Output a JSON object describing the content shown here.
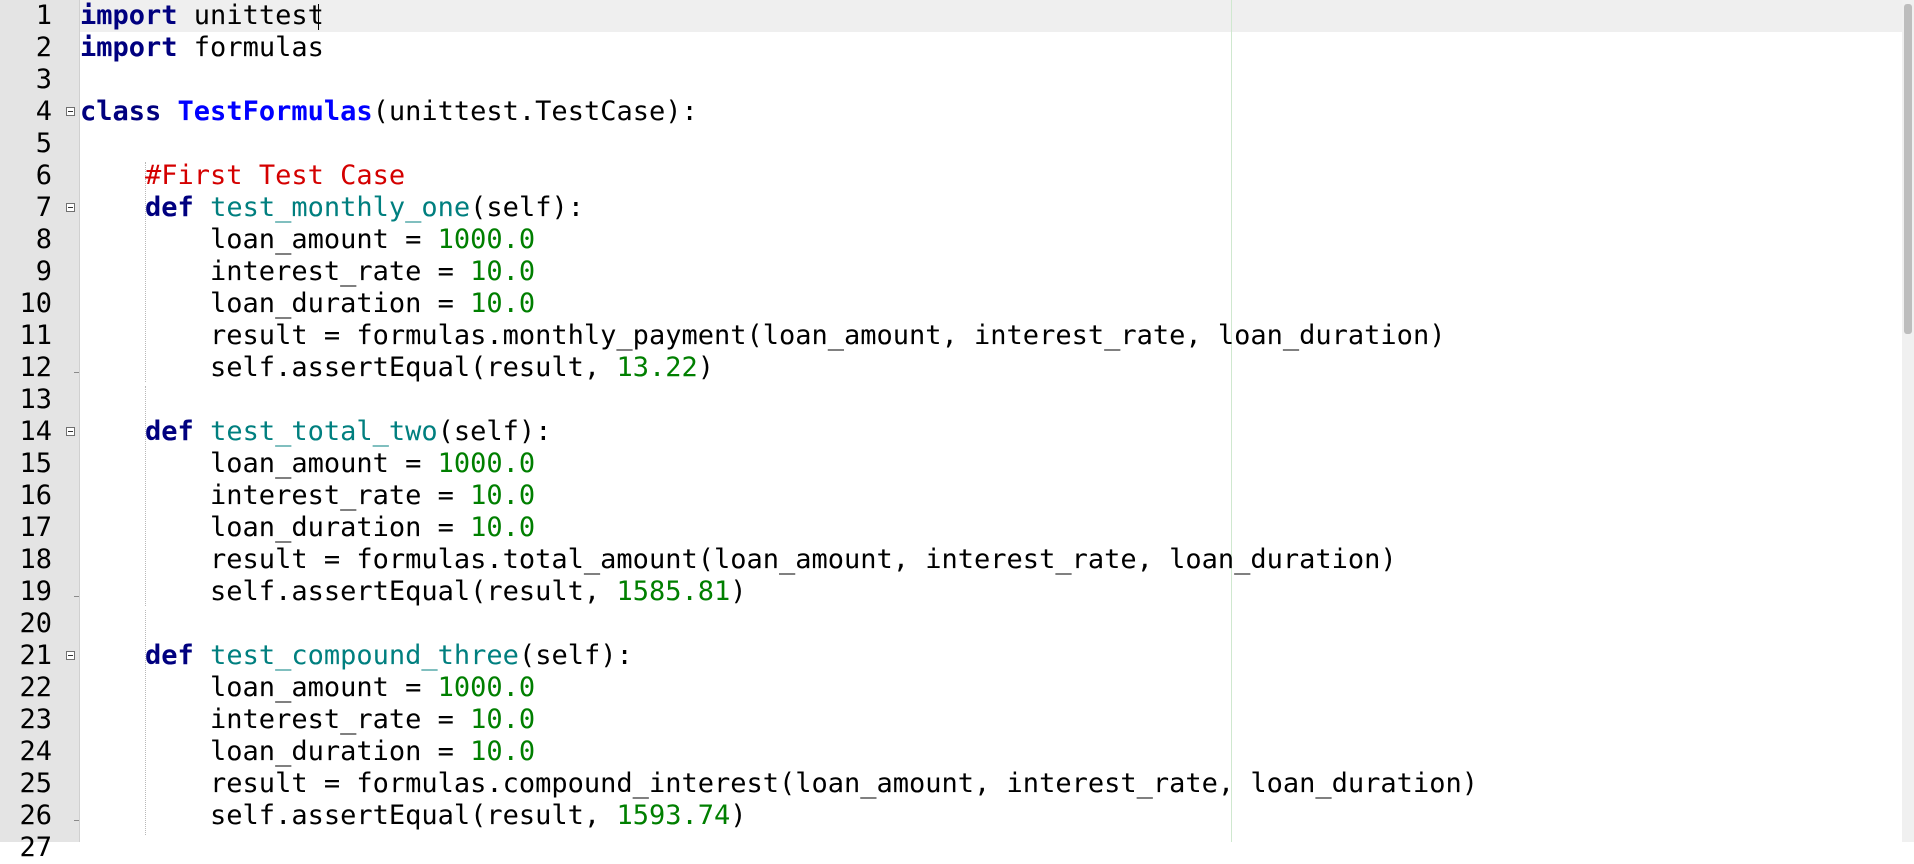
{
  "editor": {
    "line_numbers": [
      "1",
      "2",
      "3",
      "4",
      "5",
      "6",
      "7",
      "8",
      "9",
      "10",
      "11",
      "12",
      "13",
      "14",
      "15",
      "16",
      "17",
      "18",
      "19",
      "20",
      "21",
      "22",
      "23",
      "24",
      "25",
      "26",
      "27"
    ],
    "lines": [
      {
        "tokens": [
          {
            "t": "import",
            "c": "kw"
          },
          {
            "t": " unittest",
            "c": "p"
          }
        ]
      },
      {
        "tokens": [
          {
            "t": "import",
            "c": "kw"
          },
          {
            "t": " formulas",
            "c": "p"
          }
        ]
      },
      {
        "tokens": []
      },
      {
        "tokens": [
          {
            "t": "class",
            "c": "kw"
          },
          {
            "t": " ",
            "c": "p"
          },
          {
            "t": "TestFormulas",
            "c": "cls"
          },
          {
            "t": "(unittest.TestCase):",
            "c": "p"
          }
        ]
      },
      {
        "tokens": []
      },
      {
        "tokens": [
          {
            "t": "    ",
            "c": "p"
          },
          {
            "t": "#First Test Case",
            "c": "cm"
          }
        ]
      },
      {
        "tokens": [
          {
            "t": "    ",
            "c": "p"
          },
          {
            "t": "def",
            "c": "kw"
          },
          {
            "t": " ",
            "c": "p"
          },
          {
            "t": "test_monthly_one",
            "c": "fn"
          },
          {
            "t": "(self):",
            "c": "p"
          }
        ]
      },
      {
        "tokens": [
          {
            "t": "        loan_amount = ",
            "c": "p"
          },
          {
            "t": "1000.0",
            "c": "num"
          }
        ]
      },
      {
        "tokens": [
          {
            "t": "        interest_rate = ",
            "c": "p"
          },
          {
            "t": "10.0",
            "c": "num"
          }
        ]
      },
      {
        "tokens": [
          {
            "t": "        loan_duration = ",
            "c": "p"
          },
          {
            "t": "10.0",
            "c": "num"
          }
        ]
      },
      {
        "tokens": [
          {
            "t": "        result = formulas.monthly_payment(loan_amount, interest_rate, loan_duration)",
            "c": "p"
          }
        ]
      },
      {
        "tokens": [
          {
            "t": "        self.assertEqual(result, ",
            "c": "p"
          },
          {
            "t": "13.22",
            "c": "num"
          },
          {
            "t": ")",
            "c": "p"
          }
        ]
      },
      {
        "tokens": []
      },
      {
        "tokens": [
          {
            "t": "    ",
            "c": "p"
          },
          {
            "t": "def",
            "c": "kw"
          },
          {
            "t": " ",
            "c": "p"
          },
          {
            "t": "test_total_two",
            "c": "fn"
          },
          {
            "t": "(self):",
            "c": "p"
          }
        ]
      },
      {
        "tokens": [
          {
            "t": "        loan_amount = ",
            "c": "p"
          },
          {
            "t": "1000.0",
            "c": "num"
          }
        ]
      },
      {
        "tokens": [
          {
            "t": "        interest_rate = ",
            "c": "p"
          },
          {
            "t": "10.0",
            "c": "num"
          }
        ]
      },
      {
        "tokens": [
          {
            "t": "        loan_duration = ",
            "c": "p"
          },
          {
            "t": "10.0",
            "c": "num"
          }
        ]
      },
      {
        "tokens": [
          {
            "t": "        result = formulas.total_amount(loan_amount, interest_rate, loan_duration)",
            "c": "p"
          }
        ]
      },
      {
        "tokens": [
          {
            "t": "        self.assertEqual(result, ",
            "c": "p"
          },
          {
            "t": "1585.81",
            "c": "num"
          },
          {
            "t": ")",
            "c": "p"
          }
        ]
      },
      {
        "tokens": []
      },
      {
        "tokens": [
          {
            "t": "    ",
            "c": "p"
          },
          {
            "t": "def",
            "c": "kw"
          },
          {
            "t": " ",
            "c": "p"
          },
          {
            "t": "test_compound_three",
            "c": "fn"
          },
          {
            "t": "(self):",
            "c": "p"
          }
        ]
      },
      {
        "tokens": [
          {
            "t": "        loan_amount = ",
            "c": "p"
          },
          {
            "t": "1000.0",
            "c": "num"
          }
        ]
      },
      {
        "tokens": [
          {
            "t": "        interest_rate = ",
            "c": "p"
          },
          {
            "t": "10.0",
            "c": "num"
          }
        ]
      },
      {
        "tokens": [
          {
            "t": "        loan_duration = ",
            "c": "p"
          },
          {
            "t": "10.0",
            "c": "num"
          }
        ]
      },
      {
        "tokens": [
          {
            "t": "        result = formulas.compound_interest(loan_amount, interest_rate, loan_duration)",
            "c": "p"
          }
        ]
      },
      {
        "tokens": [
          {
            "t": "        self.assertEqual(result, ",
            "c": "p"
          },
          {
            "t": "1593.74",
            "c": "num"
          },
          {
            "t": ")",
            "c": "p"
          }
        ]
      },
      {
        "tokens": []
      }
    ]
  }
}
